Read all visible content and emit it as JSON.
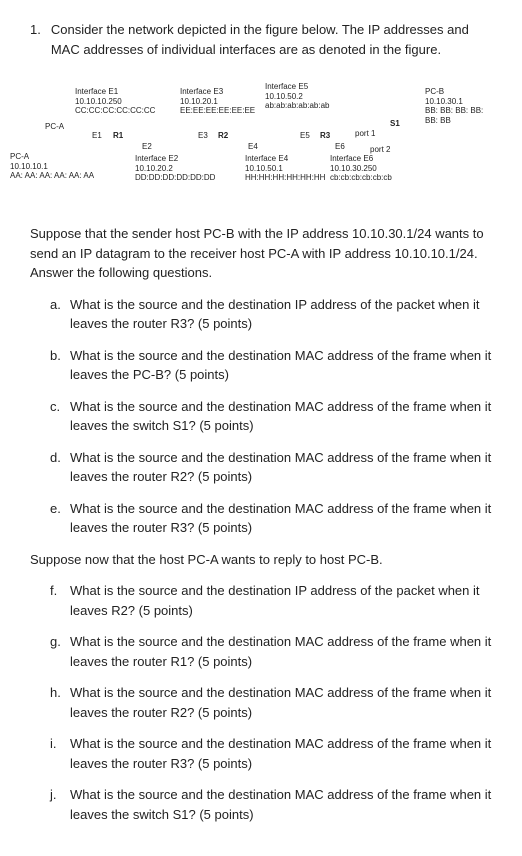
{
  "question": {
    "number": "1.",
    "text": "Consider the network depicted in the figure below. The IP addresses and MAC addresses of individual interfaces are as denoted in the figure."
  },
  "diagram": {
    "pca_left": {
      "name": "PC-A",
      "ip": "10.10.10.1",
      "mac": "AA: AA: AA: AA: AA: AA"
    },
    "interface_e1": {
      "title": "Interface E1",
      "ip": "10.10.10.250",
      "mac": "CC:CC:CC:CC:CC:CC",
      "label": "E1"
    },
    "r1_label": "R1",
    "interface_e2": {
      "title": "Interface E2",
      "ip": "10.10.20.2",
      "mac": "DD:DD:DD:DD:DD:DD",
      "label": "E2"
    },
    "interface_e3": {
      "title": "Interface E3",
      "ip": "10.10.20.1",
      "mac": "EE:EE:EE:EE:EE:EE",
      "label": "E3"
    },
    "r2_label": "R2",
    "interface_e4": {
      "title": "Interface E4",
      "ip": "10.10.50.1",
      "mac": "HH:HH:HH:HH:HH:HH",
      "label": "E4"
    },
    "interface_e5": {
      "title": "Interface E5",
      "ip": "10.10.50.2",
      "mac": "ab:ab:ab:ab:ab:ab",
      "label": "E5"
    },
    "r3_label": "R3",
    "interface_e6": {
      "title": "Interface E6",
      "ip": "10.10.30.250",
      "mac": "cb:cb:cb:cb:cb:cb",
      "label": "E6"
    },
    "s1_label": "S1",
    "port1": "port 1",
    "port2": "port 2",
    "pcb": {
      "name": "PC-B",
      "ip": "10.10.30.1",
      "mac": "BB: BB: BB: BB: BB: BB"
    },
    "pca_top": "PC-A"
  },
  "scenario1": "Suppose that the sender host PC-B with the IP address 10.10.30.1/24 wants to send an IP datagram to the receiver host PC-A with IP address 10.10.10.1/24. Answer the following questions.",
  "questions1": {
    "a": "What is the source and the destination IP address of the packet when it leaves the router R3? (5 points)",
    "b": "What is the source and the destination MAC address of the frame when it leaves the PC-B? (5 points)",
    "c": "What is the source and the destination MAC address of the frame when it leaves the switch S1? (5 points)",
    "d": "What is the source and the destination MAC address of the frame when it leaves the router R2? (5 points)",
    "e": "What is the source and the destination MAC address of the frame when it leaves the router R3? (5 points)"
  },
  "scenario2": "Suppose now that the host PC-A wants to reply to host PC-B.",
  "questions2": {
    "f": "What is the source and the destination IP address of the packet when it leaves R2? (5 points)",
    "g": "What is the source and the destination MAC address of the frame when it leaves the router R1? (5 points)",
    "h": "What is the source and the destination MAC address of the frame when it leaves the router R2? (5 points)",
    "i": "What is the source and the destination MAC address of the frame when it leaves the router R3? (5 points)",
    "j": "What is the source and the destination MAC address of the frame when it leaves the switch S1? (5 points)"
  }
}
